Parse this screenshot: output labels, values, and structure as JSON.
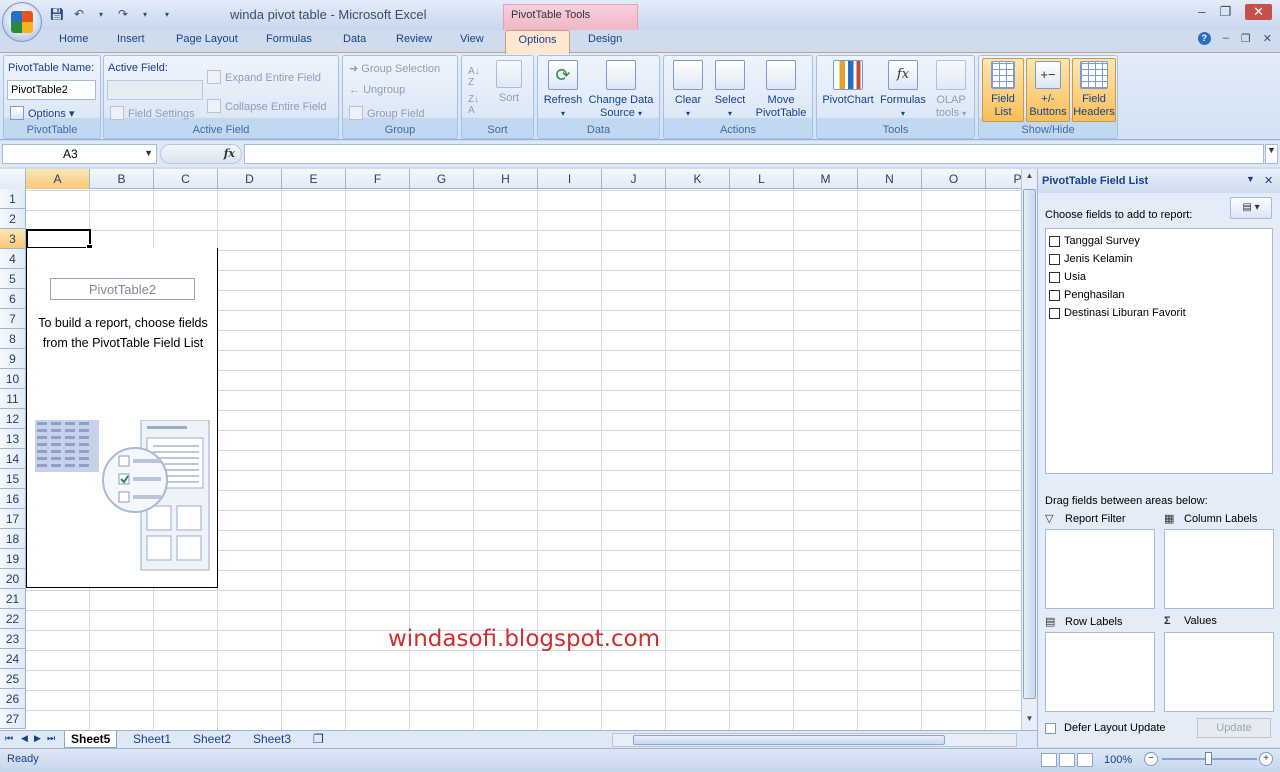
{
  "window": {
    "title": "winda pivot table  -  Microsoft Excel",
    "contextual_tab": "PivotTable Tools"
  },
  "tabs": [
    "Home",
    "Insert",
    "Page Layout",
    "Formulas",
    "Data",
    "Review",
    "View",
    "Options",
    "Design"
  ],
  "ribbon": {
    "pivottable": {
      "name_label": "PivotTable Name:",
      "name_value": "PivotTable2",
      "options_label": "Options",
      "group_label": "PivotTable"
    },
    "active_field": {
      "label": "Active Field:",
      "field_settings": "Field Settings",
      "expand": "Expand Entire Field",
      "collapse": "Collapse Entire Field",
      "group_label": "Active Field"
    },
    "group": {
      "group_selection": "Group Selection",
      "ungroup": "Ungroup",
      "group_field": "Group Field",
      "group_label": "Group"
    },
    "sort": {
      "sort_label": "Sort",
      "group_label": "Sort"
    },
    "data": {
      "refresh": "Refresh",
      "change_source_line1": "Change Data",
      "change_source_line2": "Source",
      "group_label": "Data"
    },
    "actions": {
      "clear": "Clear",
      "select": "Select",
      "move_line1": "Move",
      "move_line2": "PivotTable",
      "group_label": "Actions"
    },
    "tools": {
      "pivotchart": "PivotChart",
      "formulas": "Formulas",
      "olap_line1": "OLAP",
      "olap_line2": "tools",
      "group_label": "Tools"
    },
    "show_hide": {
      "field_list_line1": "Field",
      "field_list_line2": "List",
      "buttons_line1": "+/-",
      "buttons_line2": "Buttons",
      "headers_line1": "Field",
      "headers_line2": "Headers",
      "group_label": "Show/Hide"
    }
  },
  "formula_bar": {
    "name_box": "A3",
    "fx": "fx",
    "formula": ""
  },
  "grid": {
    "columns": [
      "A",
      "B",
      "C",
      "D",
      "E",
      "F",
      "G",
      "H",
      "I",
      "J",
      "K",
      "L",
      "M",
      "N",
      "O",
      "P"
    ],
    "rows": [
      "1",
      "2",
      "3",
      "4",
      "5",
      "6",
      "7",
      "8",
      "9",
      "10",
      "11",
      "12",
      "13",
      "14",
      "15",
      "16",
      "17",
      "18",
      "19",
      "20",
      "21",
      "22",
      "23",
      "24",
      "25",
      "26",
      "27"
    ],
    "active_column": "A",
    "active_row": "3"
  },
  "pivot_placeholder": {
    "name": "PivotTable2",
    "instructions": "To build a report, choose fields from the PivotTable Field List"
  },
  "watermark": "windasofi.blogspot.com",
  "field_list": {
    "title": "PivotTable Field List",
    "choose_label": "Choose fields to add to report:",
    "fields": [
      "Tanggal Survey",
      "Jenis Kelamin",
      "Usia",
      "Penghasilan",
      "Destinasi Liburan Favorit"
    ],
    "drag_label": "Drag fields between areas below:",
    "report_filter": "Report Filter",
    "column_labels": "Column Labels",
    "row_labels": "Row Labels",
    "values": "Values",
    "defer_label": "Defer Layout Update",
    "update_button": "Update"
  },
  "sheets": [
    "Sheet5",
    "Sheet1",
    "Sheet2",
    "Sheet3"
  ],
  "status": {
    "text": "Ready",
    "zoom": "100%"
  }
}
